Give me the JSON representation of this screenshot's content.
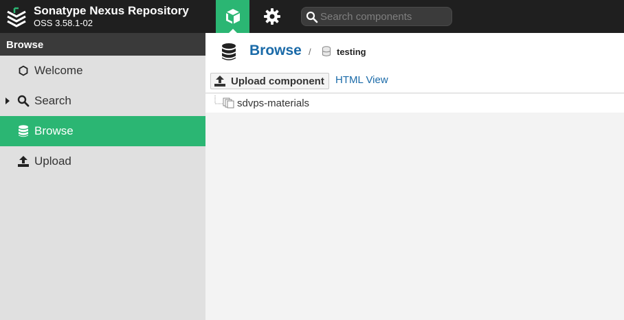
{
  "header": {
    "title": "Sonatype Nexus Repository",
    "version": "OSS 3.58.1-02",
    "search_placeholder": "Search components",
    "icons": {
      "logo": "sonatype-logo-icon",
      "browse_mode": "cube-icon",
      "admin_mode": "gear-icon",
      "search": "search-icon"
    }
  },
  "sidebar": {
    "header": "Browse",
    "items": [
      {
        "label": "Welcome",
        "icon": "hexagon-icon",
        "active": false,
        "expandable": false
      },
      {
        "label": "Search",
        "icon": "search-icon",
        "active": false,
        "expandable": true
      },
      {
        "label": "Browse",
        "icon": "database-icon",
        "active": true,
        "expandable": false
      },
      {
        "label": "Upload",
        "icon": "upload-icon",
        "active": false,
        "expandable": false
      }
    ]
  },
  "main": {
    "breadcrumb": {
      "title": "Browse",
      "separator": "/",
      "repository": "testing"
    },
    "toolbar": {
      "upload_label": "Upload component",
      "html_view_label": "HTML View"
    },
    "tree": [
      {
        "label": "sdvps-materials",
        "icon": "folder-stack-icon"
      }
    ]
  },
  "colors": {
    "accent": "#2bb673",
    "topbar": "#1f1f1f",
    "link": "#1a6aa8",
    "sidebar_bg": "#e0e0e0",
    "sidebar_header": "#3a3a3a"
  }
}
